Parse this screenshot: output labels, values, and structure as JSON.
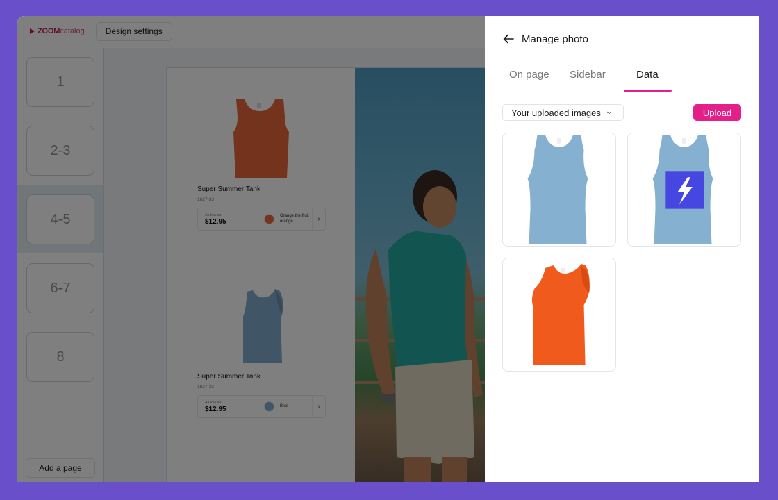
{
  "app": {
    "logo": {
      "brand_bold": "ZOOM",
      "brand_light": "catalog"
    },
    "design_settings_label": "Design settings",
    "pages": [
      {
        "label": "1",
        "selected": false
      },
      {
        "label": "2-3",
        "selected": false
      },
      {
        "label": "4-5",
        "selected": true
      },
      {
        "label": "6-7",
        "selected": false
      },
      {
        "label": "8",
        "selected": false
      }
    ],
    "add_page_label": "Add a page",
    "products": [
      {
        "name": "Super Summer Tank",
        "sku": "1627-33",
        "as_low_as": "As low as",
        "price": "$12.95",
        "color_name": "Orange the fruit orange",
        "swatch": "#e8673a",
        "image": "orange-tank"
      },
      {
        "name": "Super Summer Tank",
        "sku": "1627-33",
        "as_low_as": "As low as",
        "price": "$12.95",
        "color_name": "Blue",
        "swatch": "#80aacb",
        "image": "blue-tank"
      }
    ],
    "photo_alt": "man-in-teal-tank-top"
  },
  "panel": {
    "title": "Manage photo",
    "tabs": [
      {
        "label": "On page",
        "active": false
      },
      {
        "label": "Sidebar",
        "active": false
      },
      {
        "label": "Data",
        "active": true
      }
    ],
    "source_select": {
      "value": "Your uploaded images"
    },
    "upload_label": "Upload",
    "images": [
      {
        "name": "light-blue-tank",
        "color": "#86b0cf"
      },
      {
        "name": "light-blue-tank-with-logo",
        "color": "#86b0cf",
        "logo_color": "#4646e0"
      },
      {
        "name": "orange-tank",
        "color": "#f05a1c"
      }
    ]
  },
  "colors": {
    "accent": "#e41f8a",
    "frame": "#6a4fcb",
    "brand": "#c2185b"
  }
}
